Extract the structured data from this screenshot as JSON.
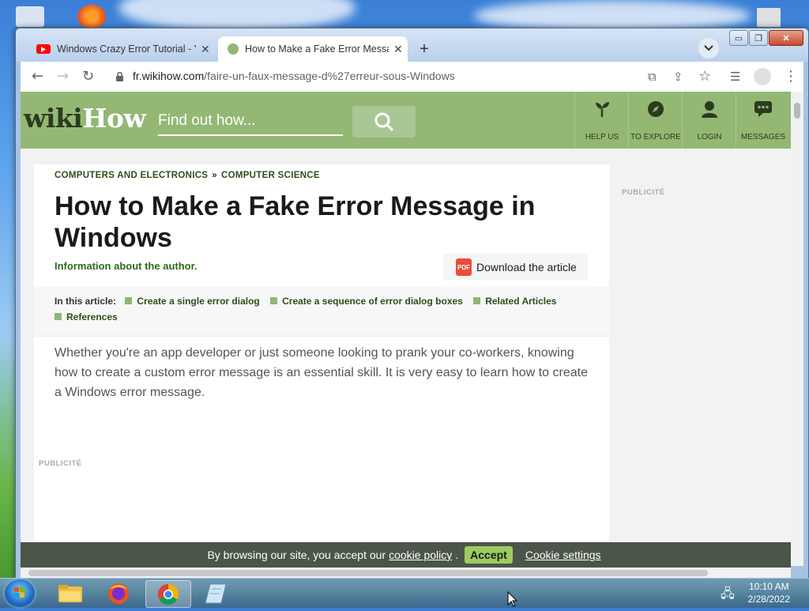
{
  "browser": {
    "tabs": [
      {
        "label": "Windows Crazy Error Tutorial - Yo",
        "close": "✕",
        "active": false
      },
      {
        "label": "How to Make a Fake Error Messa",
        "close": "✕",
        "active": true
      }
    ],
    "new_tab": "+",
    "tab_search_icon": "chevron-down",
    "window_controls": {
      "minimize": "▭",
      "restore": "❐",
      "close": "✕"
    },
    "url": {
      "domain": "fr.wikihow.com",
      "path": "/faire-un-faux-message-d%27erreur-sous-Windows"
    }
  },
  "site": {
    "logo_wiki": "wiki",
    "logo_how": "How",
    "search_placeholder": "Find out how...",
    "nav": [
      {
        "label": "HELP US",
        "icon": "sprout-icon"
      },
      {
        "label": "TO EXPLORE",
        "icon": "compass-icon"
      },
      {
        "label": "LOGIN",
        "icon": "user-icon"
      },
      {
        "label": "MESSAGES",
        "icon": "chat-icon"
      }
    ]
  },
  "article": {
    "breadcrumb": [
      "COMPUTERS AND ELECTRONICS",
      "COMPUTER SCIENCE"
    ],
    "breadcrumb_sep": "»",
    "title": "How to Make a Fake Error Message in Windows",
    "author": "Information about the author.",
    "download_label": "Download the article",
    "pdf_badge": "PDF",
    "toc_heading": "In this article:",
    "toc_items": [
      "Create a single error dialog",
      "Create a sequence of error dialog boxes",
      "Related Articles",
      "References"
    ],
    "intro": "Whether you're an app developer or just someone looking to prank your co-workers, knowing how to create a custom error message is an essential skill. It is very easy to learn how to create a Windows error message.",
    "ad_label": "PUBLICITÉ",
    "side_ad_label": "PUBLICITÉ"
  },
  "cookie": {
    "text": "By browsing our site, you accept our",
    "policy_link": "cookie policy",
    "dot": ".",
    "accept": "Accept",
    "settings": "Cookie settings"
  },
  "taskbar": {
    "apps": [
      "explorer",
      "firefox",
      "chrome",
      "notepad"
    ],
    "time": "10:10 AM",
    "date": "2/28/2022"
  },
  "colors": {
    "wikihow_green": "#93b874",
    "cookie_bar": "#4b5549",
    "accept": "#9ccb62"
  }
}
